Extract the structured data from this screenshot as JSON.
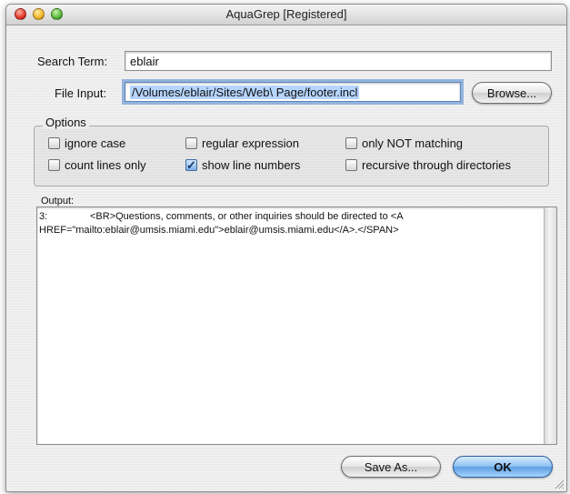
{
  "window": {
    "title": "AquaGrep [Registered]"
  },
  "search": {
    "label": "Search Term:",
    "value": "eblair"
  },
  "file": {
    "label": "File Input:",
    "value": "/Volumes/eblair/Sites/Web\\ Page/footer.incl",
    "browse_label": "Browse..."
  },
  "options": {
    "label": "Options",
    "checkboxes": [
      {
        "label": "ignore case",
        "checked": false
      },
      {
        "label": "regular expression",
        "checked": false
      },
      {
        "label": "only NOT matching",
        "checked": false
      },
      {
        "label": "count lines only",
        "checked": false
      },
      {
        "label": "show line numbers",
        "checked": true
      },
      {
        "label": "recursive through directories",
        "checked": false
      }
    ]
  },
  "output": {
    "label": "Output:",
    "line_number": "3:",
    "line1": "<BR>Questions, comments, or other inquiries should be directed to <A",
    "line2": "HREF=\"mailto:eblair@umsis.miami.edu\">eblair@umsis.miami.edu</A>.</SPAN>"
  },
  "buttons": {
    "save_as": "Save As...",
    "ok": "OK"
  },
  "colors": {
    "accent": "#5d9fe0",
    "focus_ring": "#93b4dc",
    "selection": "#b5d5fe"
  },
  "icons": {
    "checkmark": "check-icon"
  }
}
